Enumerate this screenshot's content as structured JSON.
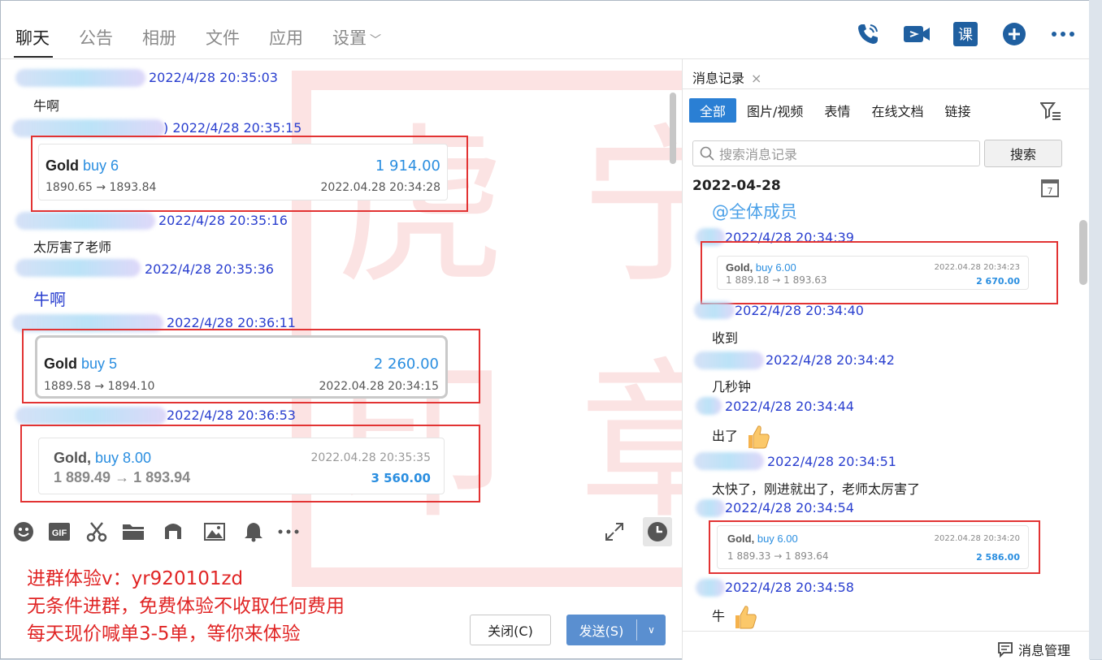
{
  "tabs": [
    {
      "label": "聊天",
      "active": true
    },
    {
      "label": "公告"
    },
    {
      "label": "相册"
    },
    {
      "label": "文件"
    },
    {
      "label": "应用"
    },
    {
      "label": "设置"
    }
  ],
  "top_icons": [
    "phone-icon",
    "video-camera-icon",
    "course-icon",
    "plus-circle-icon",
    "more-icon"
  ],
  "course_label": "课",
  "chat": {
    "messages": [
      {
        "time": "2022/4/28 20:35:03",
        "text": "牛啊"
      },
      {
        "time": ") 2022/4/28 20:35:15",
        "card": {
          "asset": "Gold",
          "side": "buy 6",
          "amount": "1 914.00",
          "range": "1890.65 → 1893.84",
          "date": "2022.04.28 20:34:28"
        }
      },
      {
        "time": "2022/4/28 20:35:16",
        "text": "太厉害了老师"
      },
      {
        "time": "2022/4/28 20:35:36",
        "text": "牛啊"
      },
      {
        "time": "2022/4/28 20:36:11",
        "card": {
          "asset": "Gold",
          "side": "buy 5",
          "amount": "2 260.00",
          "range": "1889.58 → 1894.10",
          "date": "2022.04.28 20:34:15"
        }
      },
      {
        "time": "2022/4/28 20:36:53",
        "card": {
          "asset": "Gold,",
          "side": "buy 8.00",
          "amount": "3 560.00",
          "range": "1 889.49 → 1 893.94",
          "date": "2022.04.28 20:35:35"
        }
      }
    ]
  },
  "watermark": {
    "chars": [
      "虎",
      "宁",
      "印",
      "章"
    ]
  },
  "toolbar_icons": [
    "emoji-icon",
    "gif-icon",
    "scissors-icon",
    "folder-icon",
    "music-icon",
    "image-icon",
    "bell-icon",
    "more-icon",
    "expand-icon",
    "history-icon"
  ],
  "gif_label": "GIF",
  "promo": [
    "进群体验v：yr920101zd",
    "无条件进群，免费体验不收取任何费用",
    "每天现价喊单3-5单，等你来体验"
  ],
  "buttons": {
    "close": "关闭(C)",
    "send": "发送(S)"
  },
  "history": {
    "tab_label": "消息记录",
    "filters": [
      "全部",
      "图片/视频",
      "表情",
      "在线文档",
      "链接"
    ],
    "search_placeholder": "搜索消息记录",
    "search_button": "搜索",
    "date": "2022-04-28",
    "mention": "@全体成员",
    "items": [
      {
        "time": "2022/4/28 20:34:39",
        "card": {
          "asset": "Gold,",
          "side": "buy 6.00",
          "amount": "2 670.00",
          "range": "1 889.18 → 1 893.63",
          "date": "2022.04.28 20:34:23"
        }
      },
      {
        "time": "2022/4/28 20:34:40",
        "text": "收到"
      },
      {
        "time": "2022/4/28 20:34:42",
        "text": "几秒钟"
      },
      {
        "time": "2022/4/28 20:34:44",
        "text": "出了"
      },
      {
        "time": "2022/4/28 20:34:51",
        "text": "太快了，刚进就出了，老师太厉害了"
      },
      {
        "time": "2022/4/28 20:34:54",
        "card": {
          "asset": "Gold,",
          "side": "buy 6.00",
          "amount": "2 586.00",
          "range": "1 889.33 → 1 893.64",
          "date": "2022.04.28 20:34:20"
        }
      },
      {
        "time": "2022/4/28 20:34:58",
        "text": "牛"
      }
    ],
    "footer": "消息管理"
  },
  "colors": {
    "accent": "#2a7fd4",
    "timestamp": "#2a3fcf",
    "highlight": "#e23333",
    "promo": "#e02525"
  }
}
